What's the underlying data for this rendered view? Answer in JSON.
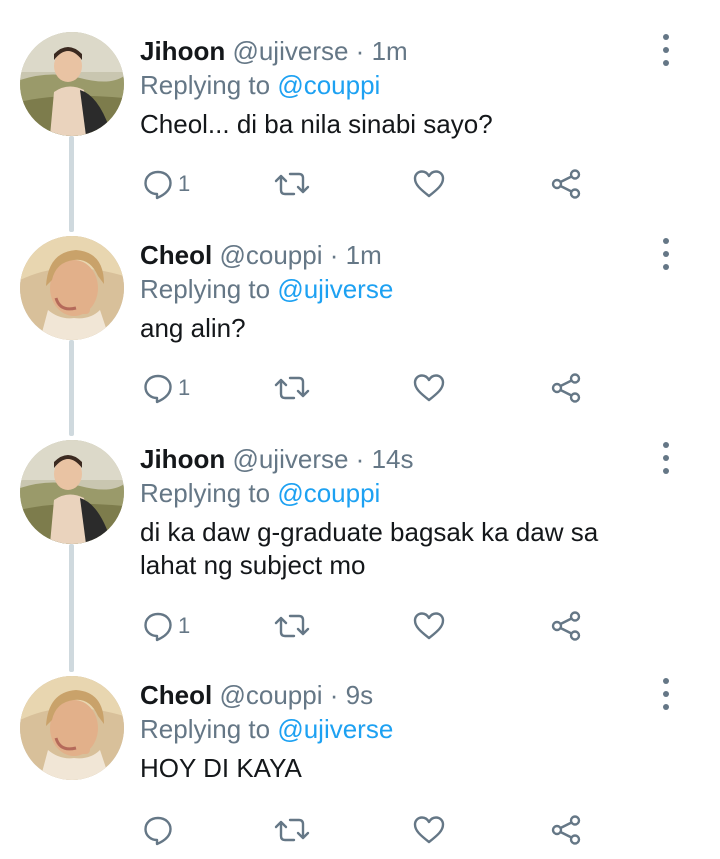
{
  "tweets": [
    {
      "name": "Jihoon",
      "handle": "@ujiverse",
      "separator": "·",
      "time": "1m",
      "replying_prefix": "Replying to",
      "replying_handle": "@couppi",
      "text": "Cheol... di ba nila sinabi sayo?",
      "reply_count": "1",
      "avatar_icon": "avatar-jihoon-photo"
    },
    {
      "name": "Cheol",
      "handle": "@couppi",
      "separator": "·",
      "time": "1m",
      "replying_prefix": "Replying to",
      "replying_handle": "@ujiverse",
      "text": "ang alin?",
      "reply_count": "1",
      "avatar_icon": "avatar-cheol-photo"
    },
    {
      "name": "Jihoon",
      "handle": "@ujiverse",
      "separator": "·",
      "time": "14s",
      "replying_prefix": "Replying to",
      "replying_handle": "@couppi",
      "text": "di ka daw g-graduate bagsak ka daw sa lahat ng subject mo",
      "reply_count": "1",
      "avatar_icon": "avatar-jihoon-photo"
    },
    {
      "name": "Cheol",
      "handle": "@couppi",
      "separator": "·",
      "time": "9s",
      "replying_prefix": "Replying to",
      "replying_handle": "@ujiverse",
      "text": "HOY DI KAYA",
      "reply_count": "",
      "avatar_icon": "avatar-cheol-photo"
    }
  ],
  "colors": {
    "link": "#1da1f2",
    "secondary": "#657786",
    "thread_line": "#cfd9de"
  },
  "icons": {
    "reply": "reply-icon",
    "retweet": "retweet-icon",
    "like": "heart-icon",
    "share": "share-icon",
    "more": "more-vertical-icon"
  }
}
